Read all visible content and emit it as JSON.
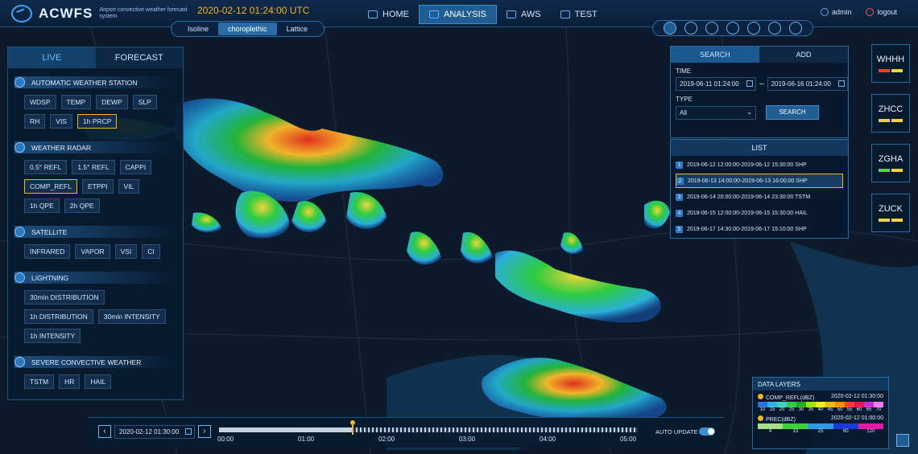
{
  "app": {
    "name": "ACWFS",
    "subtitle": "Airport convective weather forecast system",
    "datetime": "2020-02-12 01:24:00 UTC"
  },
  "nav": [
    {
      "label": "HOME",
      "icon": "grid-icon"
    },
    {
      "label": "ANALYSIS",
      "icon": "cloud-icon",
      "active": true
    },
    {
      "label": "AWS",
      "icon": "plane-icon"
    },
    {
      "label": "TEST",
      "icon": "bars-icon"
    }
  ],
  "user": {
    "name": "admin",
    "logout": "logout"
  },
  "layer_modes": [
    "Isoline",
    "choroplethic",
    "Lattice"
  ],
  "tools": [
    "map-mode-icon",
    "layers-icon",
    "globe-icon",
    "draw-icon",
    "fullscreen-icon",
    "zoom-in-icon",
    "zoom-out-icon"
  ],
  "left": {
    "tabs": [
      "LIVE",
      "FORECAST"
    ],
    "sections": [
      {
        "title": "AUTOMATIC WEATHER STATION",
        "buttons": [
          "WDSP",
          "TEMP",
          "DEWP",
          "SLP",
          "RH",
          "VIS",
          "1h PRCP"
        ],
        "selected": "1h PRCP"
      },
      {
        "title": "WEATHER RADAR",
        "buttons": [
          "0.5° REFL",
          "1.5° REFL",
          "CAPPI",
          "COMP_REFL",
          "ETPPI",
          "VIL",
          "1h QPE",
          "2h QPE"
        ],
        "selected": "COMP_REFL"
      },
      {
        "title": "SATELLITE",
        "buttons": [
          "INFRARED",
          "VAPOR",
          "VSI",
          "CI"
        ]
      },
      {
        "title": "LIGHTNING",
        "buttons": [
          "30min DISTRIBUTION",
          "1h DISTRIBUTION",
          "30min INTENSITY",
          "1h INTENSITY"
        ]
      },
      {
        "title": "SEVERE CONVECTIVE WEATHER",
        "buttons": [
          "TSTM",
          "HR",
          "HAIL"
        ]
      }
    ]
  },
  "search": {
    "tabs": [
      "SEARCH",
      "ADD"
    ],
    "time_label": "TIME",
    "start": "2019-06-11 01:24:00",
    "end": "2019-06-16 01:24:00",
    "type_label": "TYPE",
    "type_value": "All",
    "button": "SEARCH"
  },
  "list": {
    "title": "LIST",
    "items": [
      "2019-06-12 12:00:00-2019-06-12 15:30:00  SHP",
      "2019-06-13 14:00:00-2019-06-13 16:00:00  SHP",
      "2019-06-14 20:00:00-2019-06-14 23:30:00  TSTM",
      "2019-06-15 12:00:00-2019-06-15 15:30:00  HAIL",
      "2019-06-17 14:30:00-2019-06-17 15:10:00  SHP"
    ],
    "selected_index": 1
  },
  "airports": [
    {
      "code": "WHHH",
      "bars": [
        "#ff3b30",
        "#f0d43a"
      ]
    },
    {
      "code": "ZHCC",
      "bars": [
        "#f0d43a",
        "#f0d43a"
      ]
    },
    {
      "code": "ZGHA",
      "bars": [
        "#5ed14a",
        "#f0d43a"
      ]
    },
    {
      "code": "ZUCK",
      "bars": [
        "#f0d43a",
        "#f0d43a"
      ]
    }
  ],
  "timeline": {
    "date": "2020-02-12 01:30:00",
    "ticks": [
      "00:00",
      "01:00",
      "02:00",
      "03:00",
      "04:00",
      "05:00"
    ],
    "progress": 0.32,
    "auto_update": "AUTO UPDATE"
  },
  "data_layers": {
    "title": "DATA LAYERS",
    "layers": [
      {
        "name": "COMP_REFL(dBZ)",
        "time": "2020-02-12 01:30:00",
        "scale": [
          "10",
          "15",
          "20",
          "25",
          "30",
          "35",
          "40",
          "45",
          "50",
          "55",
          "60",
          "65",
          "70"
        ],
        "colors": [
          "#2d6fe0",
          "#2fb3e6",
          "#3fd1c0",
          "#2ecc40",
          "#22a832",
          "#9be01e",
          "#f0e830",
          "#f0b429",
          "#ff8c1a",
          "#ff3b30",
          "#d61e4d",
          "#c62bd8",
          "#f07cf0"
        ]
      },
      {
        "name": "PREC(dBZ)",
        "time": "2020-02-12 01:00:00",
        "scale": [
          "4",
          "13",
          "25",
          "60",
          "120"
        ],
        "colors": [
          "#a6e08c",
          "#3fd13a",
          "#2f9be6",
          "#1c3bd6",
          "#d61ea8"
        ]
      }
    ]
  }
}
